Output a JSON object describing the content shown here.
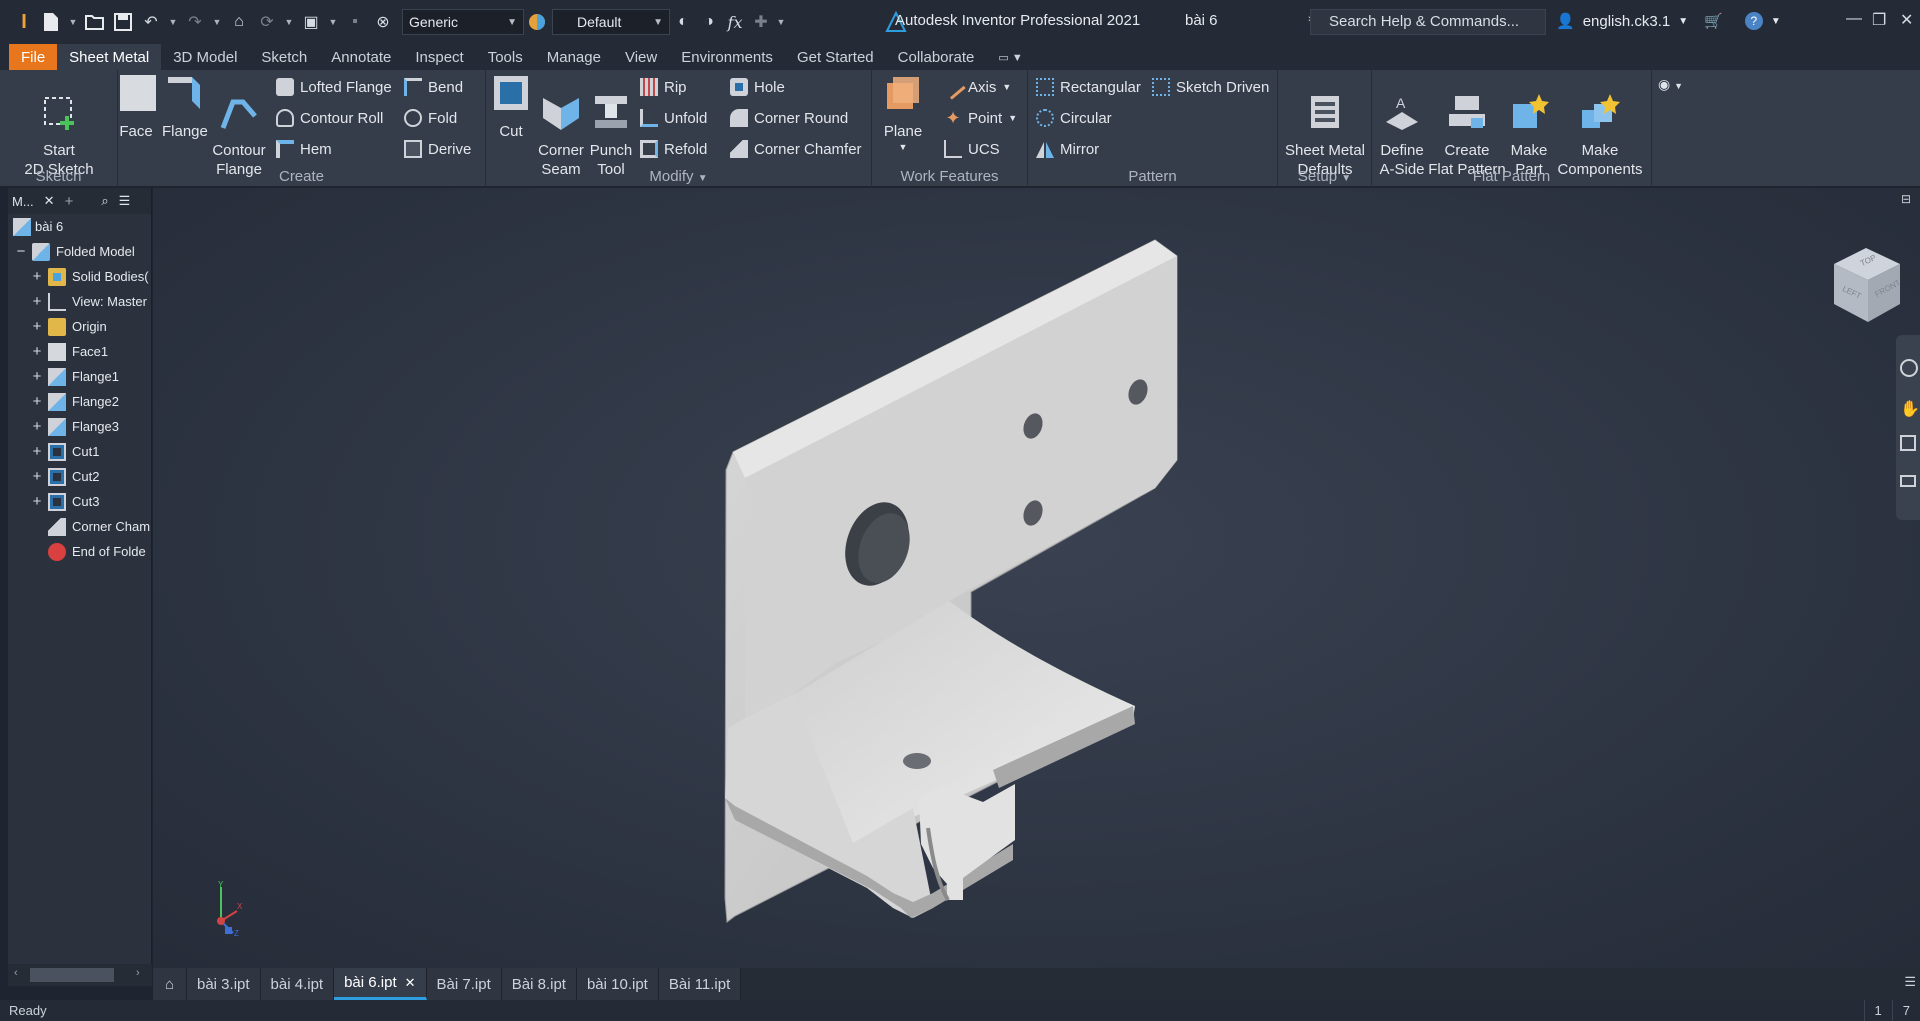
{
  "titlebar": {
    "style_combo": "Generic",
    "appearance_combo": "Default",
    "app_title": "Autodesk Inventor Professional 2021",
    "file_name": "bài 6",
    "search_placeholder": "Search Help & Commands...",
    "user": "english.ck3.1"
  },
  "tabs": [
    "File",
    "Sheet Metal",
    "3D Model",
    "Sketch",
    "Annotate",
    "Inspect",
    "Tools",
    "Manage",
    "View",
    "Environments",
    "Get Started",
    "Collaborate"
  ],
  "ribbon": {
    "sketch_panel": {
      "title": "Sketch",
      "start_sketch": "Start\n2D Sketch"
    },
    "create_panel": {
      "title": "Create",
      "face": "Face",
      "flange": "Flange",
      "contour_flange": "Contour\nFlange",
      "lofted_flange": "Lofted Flange",
      "contour_roll": "Contour Roll",
      "hem": "Hem",
      "bend": "Bend",
      "fold": "Fold",
      "derive": "Derive"
    },
    "modify_panel": {
      "title": "Modify",
      "cut": "Cut",
      "corner_seam": "Corner\nSeam",
      "punch_tool": "Punch\nTool",
      "rip": "Rip",
      "unfold": "Unfold",
      "refold": "Refold",
      "hole": "Hole",
      "corner_round": "Corner Round",
      "corner_chamfer": "Corner Chamfer"
    },
    "work_features_panel": {
      "title": "Work Features",
      "plane": "Plane",
      "axis": "Axis",
      "point": "Point",
      "ucs": "UCS"
    },
    "pattern_panel": {
      "title": "Pattern",
      "rectangular": "Rectangular",
      "circular": "Circular",
      "mirror": "Mirror",
      "sketch_driven": "Sketch Driven"
    },
    "setup_panel": {
      "title": "Setup",
      "defaults": "Sheet Metal\nDefaults"
    },
    "flat_pattern_panel": {
      "title": "Flat Pattern",
      "define_a_side": "Define\nA-Side",
      "create_flat_pattern": "Create\nFlat Pattern",
      "make_part": "Make\nPart",
      "make_components": "Make\nComponents"
    }
  },
  "browser": {
    "tab_label": "M...",
    "root": "bài 6",
    "nodes": [
      {
        "label": "Folded Model",
        "level": 0,
        "expander": "−",
        "icon": "folded-model"
      },
      {
        "label": "Solid Bodies(",
        "level": 1,
        "expander": "+",
        "icon": "folder-bodies"
      },
      {
        "label": "View: Master",
        "level": 1,
        "expander": "+",
        "icon": "view"
      },
      {
        "label": "Origin",
        "level": 1,
        "expander": "+",
        "icon": "folder"
      },
      {
        "label": "Face1",
        "level": 1,
        "expander": "+",
        "icon": "face"
      },
      {
        "label": "Flange1",
        "level": 1,
        "expander": "+",
        "icon": "flange"
      },
      {
        "label": "Flange2",
        "level": 1,
        "expander": "+",
        "icon": "flange"
      },
      {
        "label": "Flange3",
        "level": 1,
        "expander": "+",
        "icon": "flange"
      },
      {
        "label": "Cut1",
        "level": 1,
        "expander": "+",
        "icon": "cut"
      },
      {
        "label": "Cut2",
        "level": 1,
        "expander": "+",
        "icon": "cut"
      },
      {
        "label": "Cut3",
        "level": 1,
        "expander": "+",
        "icon": "cut"
      },
      {
        "label": "Corner Cham",
        "level": 1,
        "expander": "",
        "icon": "chamfer"
      },
      {
        "label": "End of Folde",
        "level": 1,
        "expander": "",
        "icon": "end-error"
      }
    ]
  },
  "doc_tabs": [
    "bài 3.ipt",
    "bài 4.ipt",
    "bài 6.ipt",
    "Bài 7.ipt",
    "Bài 8.ipt",
    "bài 10.ipt",
    "Bài 11.ipt"
  ],
  "active_doc": "bài 6.ipt",
  "viewcube": {
    "top": "TOP",
    "left": "LEFT",
    "front": "FRONT"
  },
  "status": {
    "text": "Ready",
    "right1": "1",
    "right2": "7"
  },
  "colors": {
    "file_tab": "#e8761c",
    "active_tab_underline": "#2f9ee0",
    "background": "#2d3442"
  }
}
